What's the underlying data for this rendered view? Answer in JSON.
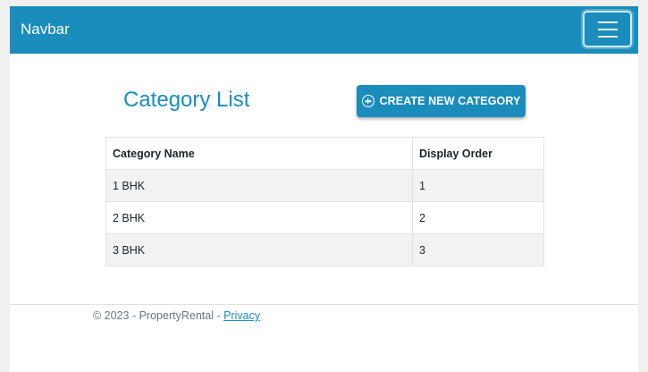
{
  "navbar": {
    "brand": "Navbar",
    "toggler_icon": "hamburger-menu-icon"
  },
  "page": {
    "title": "Category List",
    "create_button_label": "CREATE NEW CATEGORY",
    "create_button_icon": "plus-circle-icon"
  },
  "table": {
    "headers": [
      "Category Name",
      "Display Order"
    ],
    "rows": [
      {
        "name": "1 BHK",
        "order": "1"
      },
      {
        "name": "2 BHK",
        "order": "2"
      },
      {
        "name": "3 BHK",
        "order": "3"
      }
    ]
  },
  "footer": {
    "text": "© 2023 - PropertyRental - ",
    "privacy_link": "Privacy"
  },
  "colors": {
    "primary": "#1a8dbd",
    "striped_row": "#f2f2f2",
    "footer_text": "#6c757d"
  }
}
